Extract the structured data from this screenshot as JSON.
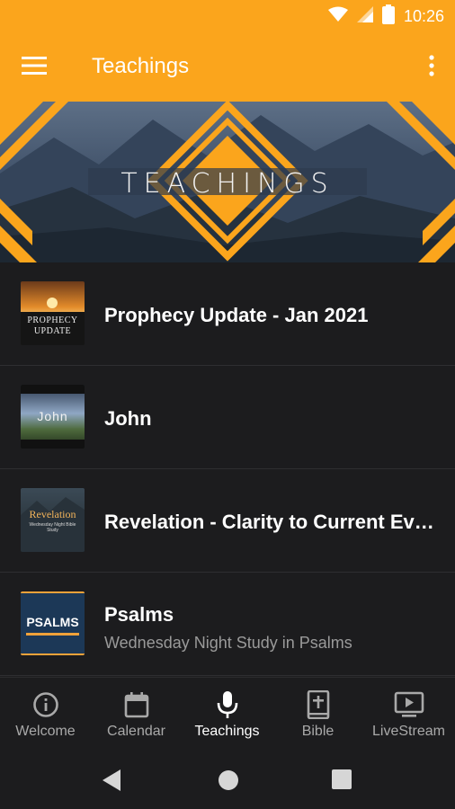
{
  "status_bar": {
    "time": "10:26"
  },
  "app_bar": {
    "title": "Teachings"
  },
  "banner": {
    "text": "TEACHINGS"
  },
  "teachings": [
    {
      "title": "Prophecy Update - Jan 2021",
      "subtitle": "",
      "thumb_text": "PROPHECY UPDATE"
    },
    {
      "title": "John",
      "subtitle": "",
      "thumb_text": "John"
    },
    {
      "title": "Revelation - Clarity to Current Ev…",
      "subtitle": "",
      "thumb_text": "Revelation",
      "thumb_small_text": "Wednesday Night Bible Study"
    },
    {
      "title": "Psalms",
      "subtitle": "Wednesday Night Study in Psalms",
      "thumb_text": "PSALMS"
    }
  ],
  "bottom_nav": [
    {
      "label": "Welcome",
      "icon": "info-icon",
      "active": false
    },
    {
      "label": "Calendar",
      "icon": "calendar-icon",
      "active": false
    },
    {
      "label": "Teachings",
      "icon": "microphone-icon",
      "active": true
    },
    {
      "label": "Bible",
      "icon": "bible-icon",
      "active": false
    },
    {
      "label": "LiveStream",
      "icon": "play-screen-icon",
      "active": false
    }
  ],
  "colors": {
    "accent": "#fba51c",
    "background": "#1e1e20",
    "active_nav": "#ffffff",
    "inactive_nav": "#a9a9a9"
  }
}
